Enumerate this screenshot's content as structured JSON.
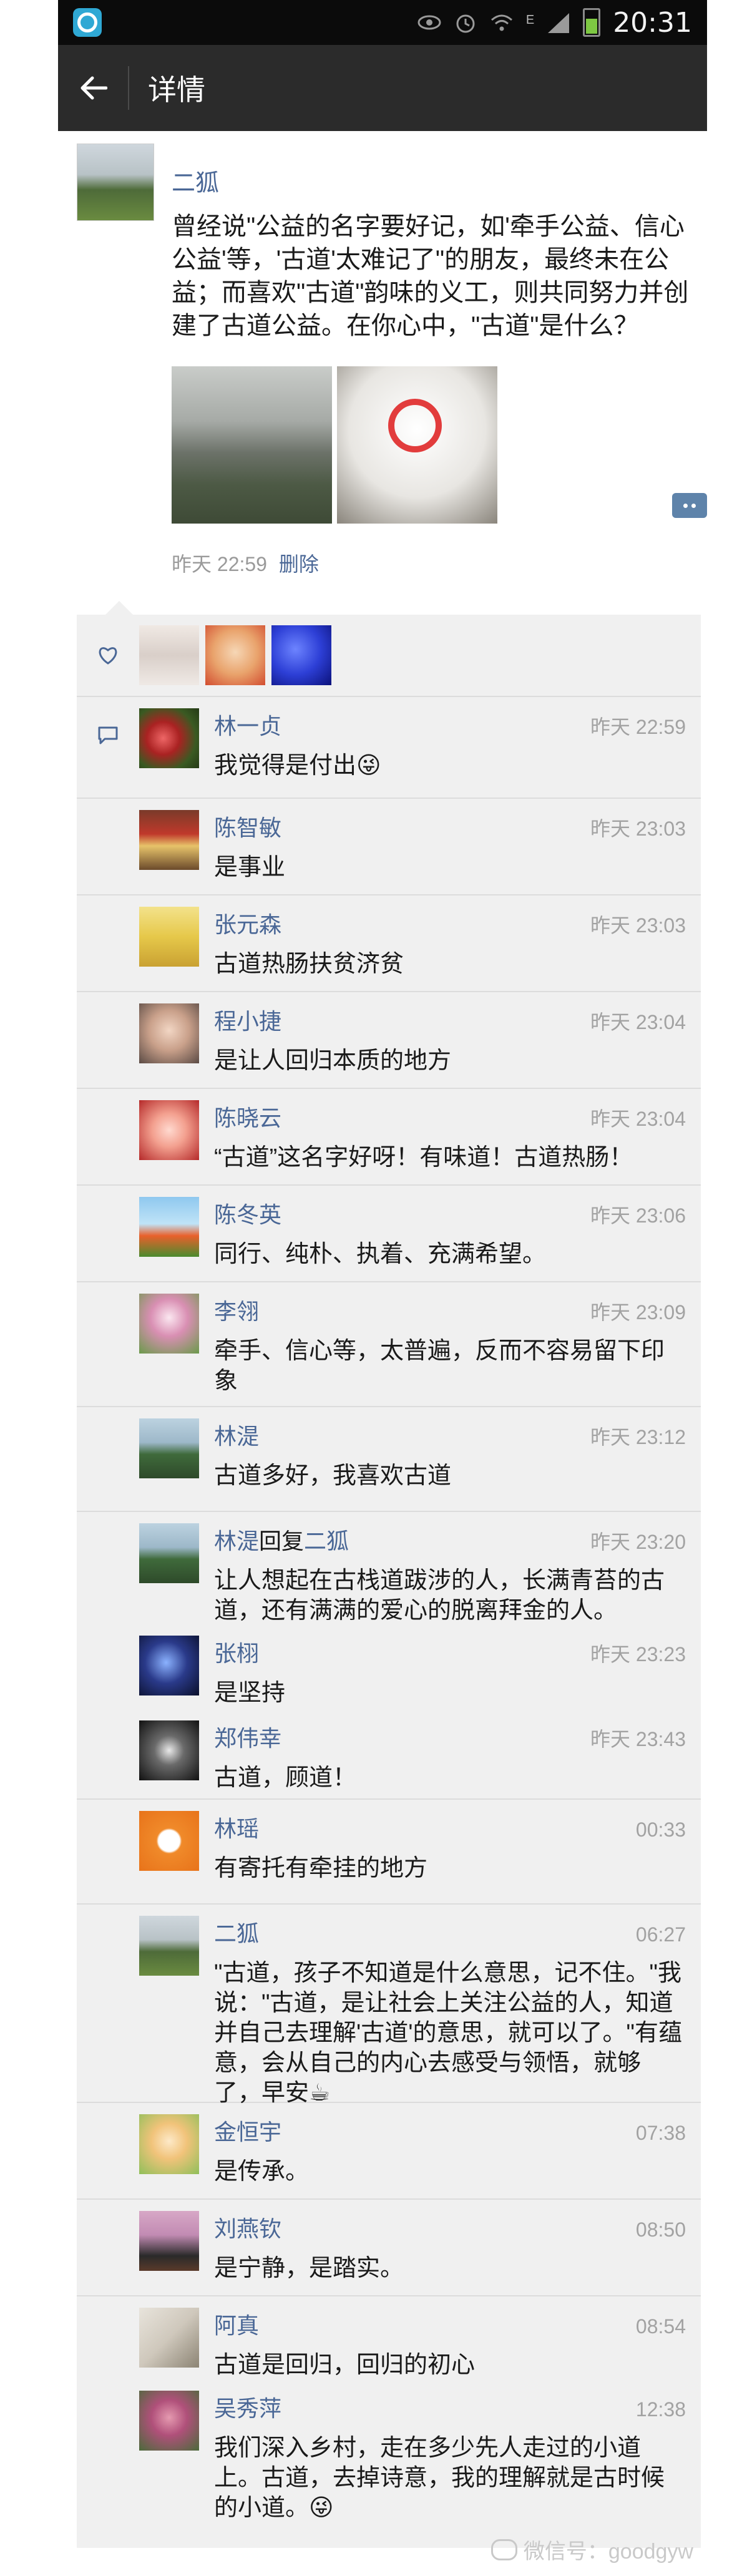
{
  "status": {
    "time": "20:31",
    "network": "E"
  },
  "header": {
    "title": "详情"
  },
  "post": {
    "author": "二狐",
    "text": "曾经说\"公益的名字要好记，如'牵手公益、信心公益'等，'古道'太难记了\"的朋友，最终未在公益；而喜欢\"古道\"韵味的义工，则共同努力并创建了古道公益。在你心中，\"古道\"是什么？",
    "time": "昨天 22:59",
    "delete_label": "删除"
  },
  "comments": [
    {
      "name": "林一贞",
      "time": "昨天 22:59",
      "text": "我觉得是付出😜"
    },
    {
      "name": "陈智敏",
      "time": "昨天 23:03",
      "text": "是事业"
    },
    {
      "name": "张元森",
      "time": "昨天 23:03",
      "text": "古道热肠扶贫济贫"
    },
    {
      "name": "程小捷",
      "time": "昨天 23:04",
      "text": "是让人回归本质的地方"
    },
    {
      "name": "陈晓云",
      "time": "昨天 23:04",
      "text": "“古道”这名字好呀！有味道！古道热肠！"
    },
    {
      "name": "陈冬英",
      "time": "昨天 23:06",
      "text": "同行、纯朴、执着、充满希望。"
    },
    {
      "name": "李翎",
      "time": "昨天 23:09",
      "text": "牵手、信心等，太普遍，反而不容易留下印象"
    },
    {
      "name": "林湜",
      "time": "昨天 23:12",
      "text": "古道多好，我喜欢古道"
    },
    {
      "name": "林湜",
      "reply_word": "回复",
      "reply_to": "二狐",
      "time": "昨天 23:20",
      "text": "让人想起在古栈道跋涉的人，长满青苔的古道，还有满满的爱心的脱离拜金的人。"
    },
    {
      "name": "张栩",
      "time": "昨天 23:23",
      "text": "是坚持"
    },
    {
      "name": "郑伟幸",
      "time": "昨天 23:43",
      "text": "古道，顾道！"
    },
    {
      "name": "林瑶",
      "time": "00:33",
      "text": "有寄托有牵挂的地方"
    },
    {
      "name": "二狐",
      "time": "06:27",
      "text": "\"古道，孩子不知道是什么意思，记不住。\"我说：\"古道，是让社会上关注公益的人，知道并自己去理解'古道'的意思，就可以了。\"有蕴意，会从自己的内心去感受与领悟，就够了，早安☕"
    },
    {
      "name": "金恒宇",
      "time": "07:38",
      "text": "是传承。"
    },
    {
      "name": "刘燕钦",
      "time": "08:50",
      "text": "是宁静，是踏实。"
    },
    {
      "name": "阿真",
      "time": "08:54",
      "text": "古道是回归，回归的初心"
    },
    {
      "name": "吴秀萍",
      "time": "12:38",
      "text": "我们深入乡村，走在多少先人走过的小道上。古道，去掉诗意，我的理解就是古时候的小道。😜"
    }
  ],
  "watermark": "微信号：goodgyw",
  "colors": {
    "name_blue": "#4a6796",
    "action_bar": "#2b2b2b",
    "panel_bg": "#f0f0f0"
  }
}
